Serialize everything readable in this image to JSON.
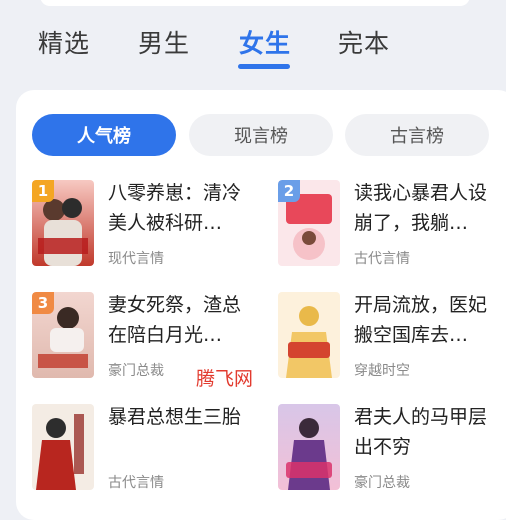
{
  "top_tabs": [
    {
      "label": "精选",
      "active": false
    },
    {
      "label": "男生",
      "active": false
    },
    {
      "label": "女生",
      "active": true
    },
    {
      "label": "完本",
      "active": false
    }
  ],
  "rank_tabs": [
    {
      "label": "人气榜",
      "active": true
    },
    {
      "label": "现言榜",
      "active": false
    },
    {
      "label": "古言榜",
      "active": false
    }
  ],
  "books": [
    {
      "rank": "1",
      "title": "八零养崽：清冷美人被科研…",
      "genre": "现代言情",
      "rank_color": "#f4a623"
    },
    {
      "rank": "2",
      "title": "读我心暴君人设崩了，我躺…",
      "genre": "古代言情",
      "rank_color": "#6a9ee8"
    },
    {
      "rank": "3",
      "title": "妻女死祭，渣总在陪白月光…",
      "genre": "豪门总裁",
      "rank_color": "#f08a44"
    },
    {
      "rank": "",
      "title": "开局流放，医妃搬空国库去…",
      "genre": "穿越时空",
      "rank_color": ""
    },
    {
      "rank": "",
      "title": "暴君总想生三胎",
      "genre": "古代言情",
      "rank_color": ""
    },
    {
      "rank": "",
      "title": "君夫人的马甲层出不穷",
      "genre": "豪门总裁",
      "rank_color": ""
    }
  ],
  "watermark": "腾飞网",
  "colors": {
    "accent": "#2f74ea"
  }
}
